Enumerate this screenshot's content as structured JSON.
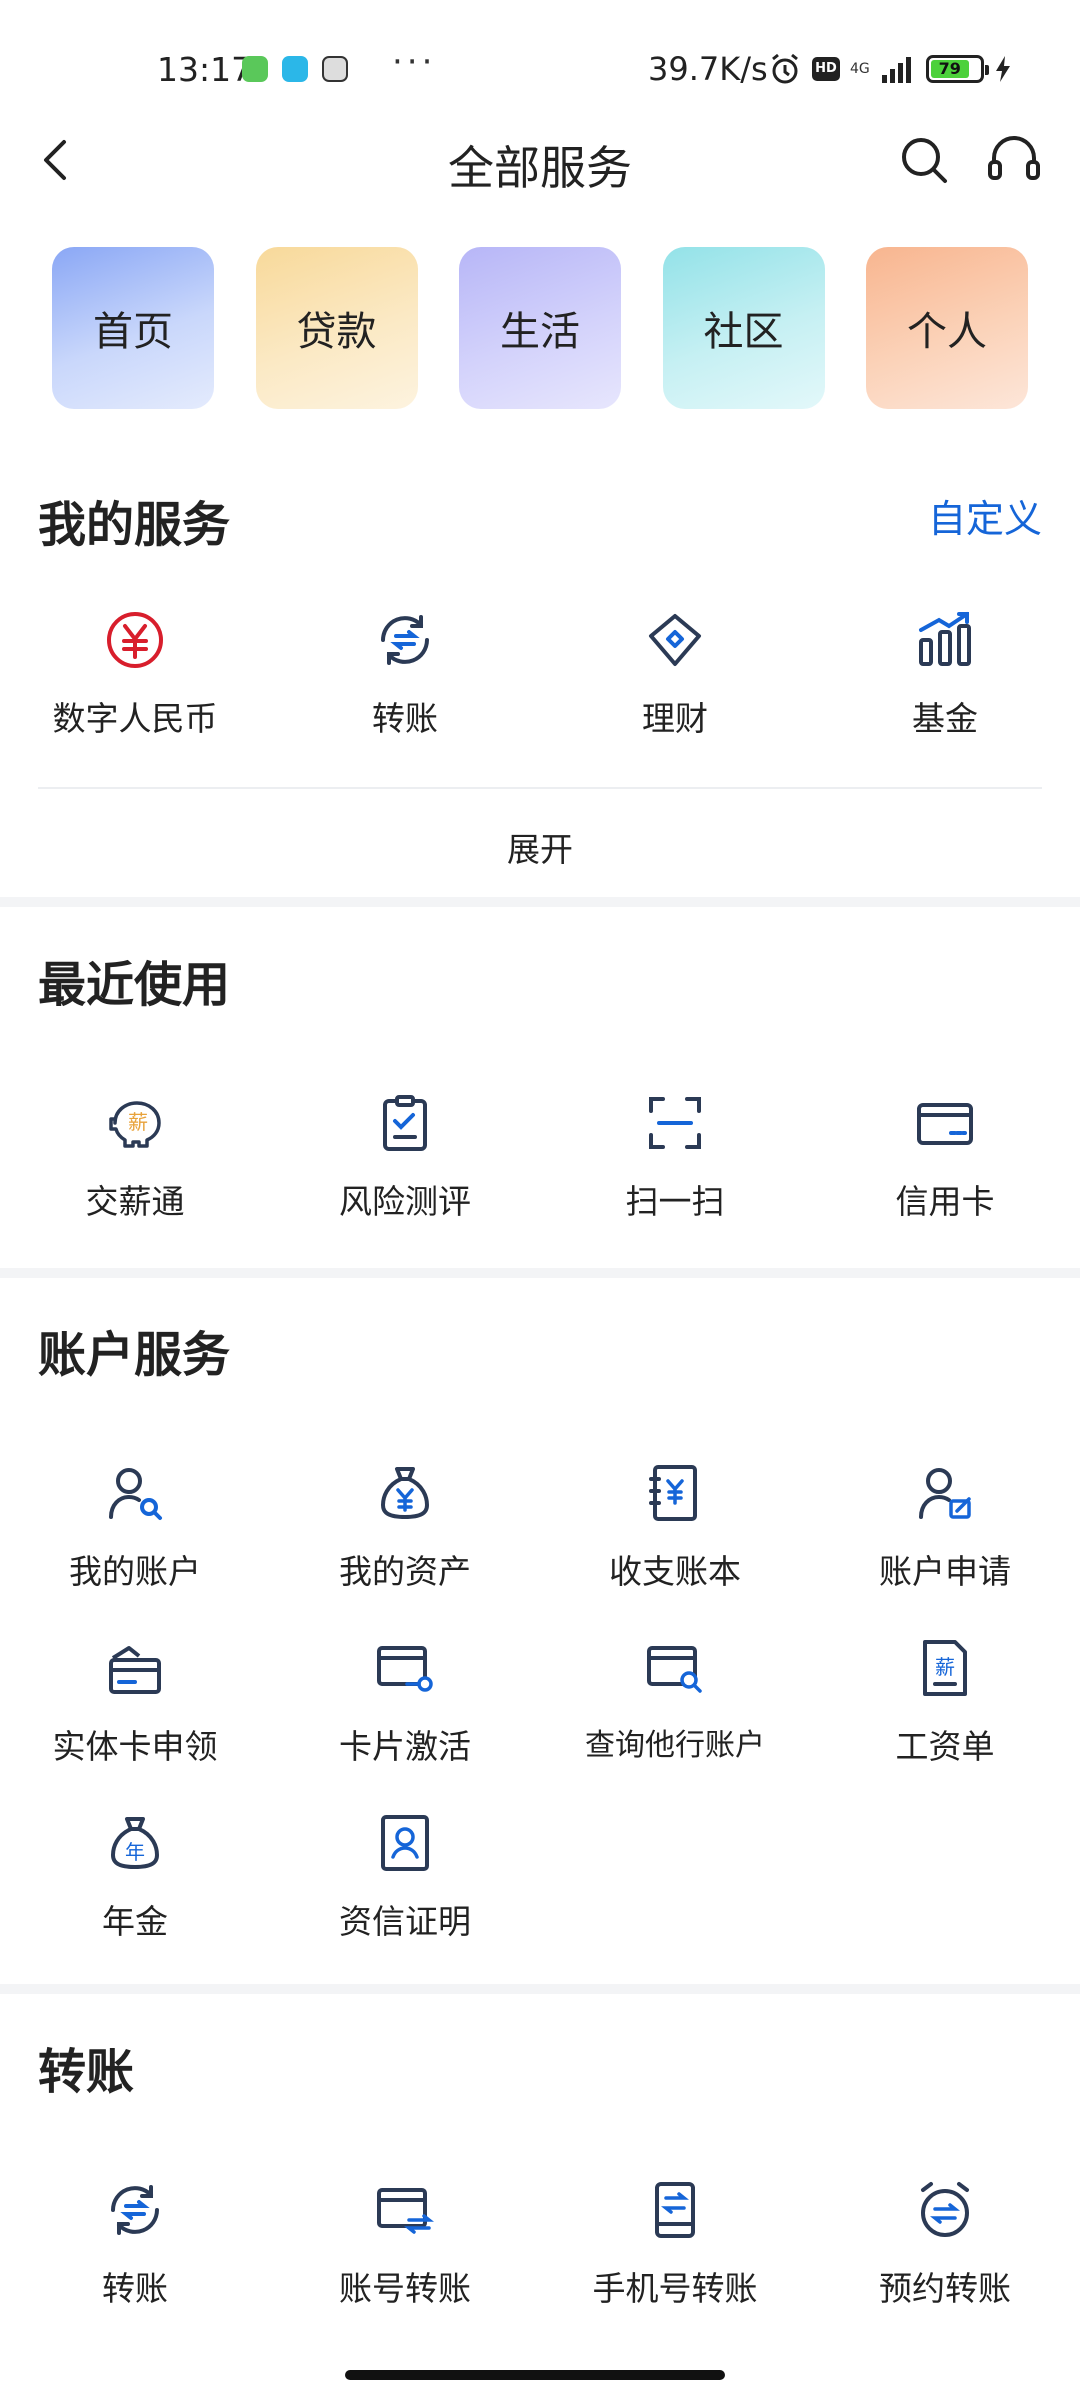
{
  "status_bar": {
    "time": "13:17",
    "more": "···",
    "net_speed": "39.7K/s",
    "hd": "HD",
    "network": "4G",
    "battery": "79"
  },
  "header": {
    "title": "全部服务"
  },
  "categories": [
    {
      "label": "首页"
    },
    {
      "label": "贷款"
    },
    {
      "label": "生活"
    },
    {
      "label": "社区"
    },
    {
      "label": "个人"
    }
  ],
  "my_services": {
    "title": "我的服务",
    "customize_label": "自定义",
    "items": [
      {
        "label": "数字人民币",
        "icon": "yuan-icon"
      },
      {
        "label": "转账",
        "icon": "transfer-icon"
      },
      {
        "label": "理财",
        "icon": "diamond-icon"
      },
      {
        "label": "基金",
        "icon": "bar-chart-icon"
      }
    ],
    "expand_label": "展开"
  },
  "recent": {
    "title": "最近使用",
    "items": [
      {
        "label": "交薪通",
        "icon": "piggy-bank-icon"
      },
      {
        "label": "风险测评",
        "icon": "clipboard-check-icon"
      },
      {
        "label": "扫一扫",
        "icon": "scan-icon"
      },
      {
        "label": "信用卡",
        "icon": "credit-card-icon"
      }
    ]
  },
  "account_services": {
    "title": "账户服务",
    "items": [
      {
        "label": "我的账户",
        "icon": "user-search-icon"
      },
      {
        "label": "我的资产",
        "icon": "money-bag-icon"
      },
      {
        "label": "收支账本",
        "icon": "ledger-icon"
      },
      {
        "label": "账户申请",
        "icon": "user-edit-icon"
      },
      {
        "label": "实体卡申领",
        "icon": "card-apply-icon"
      },
      {
        "label": "卡片激活",
        "icon": "card-activate-icon"
      },
      {
        "label": "查询他行账户",
        "icon": "card-search-icon"
      },
      {
        "label": "工资单",
        "icon": "payslip-icon"
      },
      {
        "label": "年金",
        "icon": "annuity-icon"
      },
      {
        "label": "资信证明",
        "icon": "certificate-icon"
      }
    ]
  },
  "transfer": {
    "title": "转账",
    "items": [
      {
        "label": "转账",
        "icon": "transfer-icon"
      },
      {
        "label": "账号转账",
        "icon": "card-transfer-icon"
      },
      {
        "label": "手机号转账",
        "icon": "phone-transfer-icon"
      },
      {
        "label": "预约转账",
        "icon": "alarm-transfer-icon"
      }
    ]
  },
  "colors": {
    "accent_blue": "#1565d8",
    "icon_dark": "#2b3a55",
    "rmb_red": "#d81e2c",
    "salary_orange": "#e8a23a"
  }
}
